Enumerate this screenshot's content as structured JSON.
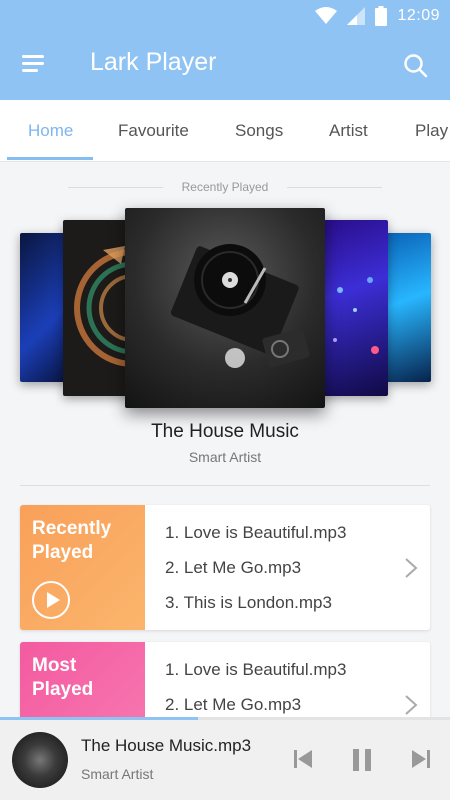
{
  "status": {
    "time": "12:09"
  },
  "appbar": {
    "title": "Lark Player"
  },
  "tabs": [
    {
      "label": "Home",
      "active": true
    },
    {
      "label": "Favourite",
      "active": false
    },
    {
      "label": "Songs",
      "active": false
    },
    {
      "label": "Artist",
      "active": false
    },
    {
      "label": "Play",
      "active": false
    }
  ],
  "recent": {
    "header": "Recently Played",
    "featured": {
      "title": "The House Music",
      "artist": "Smart Artist"
    }
  },
  "cards": [
    {
      "label": "Recently Played",
      "tracks": [
        "1. Love is Beautiful.mp3",
        "2. Let Me Go.mp3",
        "3. This is London.mp3"
      ]
    },
    {
      "label": "Most Played",
      "tracks": [
        "1. Love is Beautiful.mp3",
        "2. Let Me Go.mp3"
      ]
    }
  ],
  "player": {
    "title": "The House Music.mp3",
    "artist": "Smart Artist",
    "progress": 0.44
  },
  "colors": {
    "accent": "#8fc3f4",
    "recent_card": "#f9a25a",
    "most_card": "#f45aa0"
  }
}
